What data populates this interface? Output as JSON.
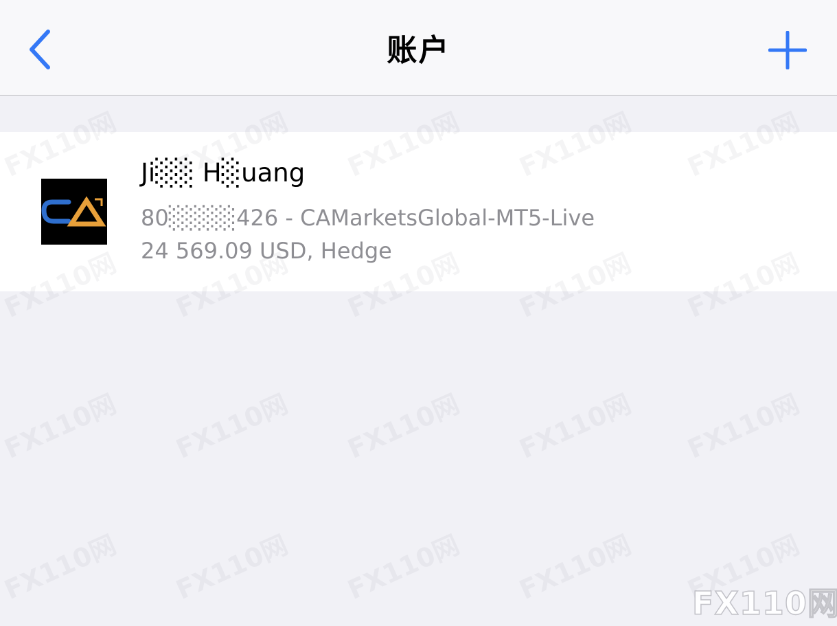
{
  "nav": {
    "title": "账户",
    "back_icon": "chevron-left-icon",
    "add_icon": "plus-icon",
    "accent_color": "#3478f6"
  },
  "accounts": [
    {
      "name": "Ji░░ H░uang",
      "server_line": "80░░░░426 - CAMarketsGlobal-MT5-Live",
      "balance_line": "24 569.09 USD, Hedge",
      "logo_text": "CA",
      "logo_colors": {
        "background": "#000000",
        "c": "#2f6fce",
        "a": "#e8a03a"
      }
    }
  ],
  "watermark": {
    "text": "FX110网"
  },
  "corner_logo": {
    "text": "FX110网"
  }
}
